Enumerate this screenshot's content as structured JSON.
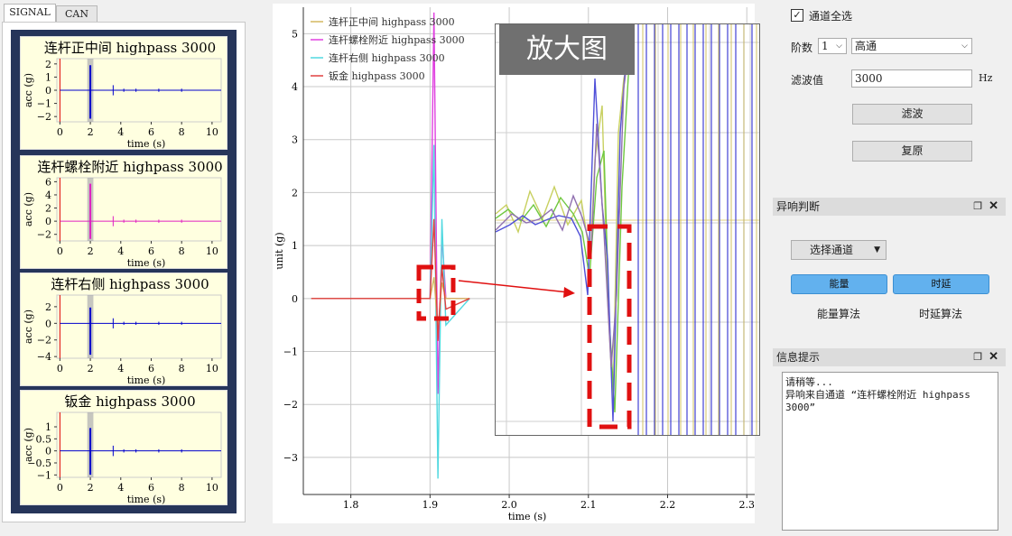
{
  "tabs": [
    {
      "label": "SIGNAL"
    },
    {
      "label": "CAN"
    }
  ],
  "minis": [
    {
      "title": "连杆正中间 highpass 3000",
      "color": "#0000cc",
      "yticks": [
        "2",
        "1",
        "0",
        "−1",
        "−2"
      ],
      "yvals": [
        2,
        1,
        0,
        -1,
        -2
      ],
      "ymin": -2.4,
      "ymax": 2.4
    },
    {
      "title": "连杆螺栓附近 highpass 3000",
      "color": "#e020c0",
      "yticks": [
        "6",
        "4",
        "2",
        "0",
        "−2"
      ],
      "yvals": [
        6,
        4,
        2,
        0,
        -2
      ],
      "ymin": -3,
      "ymax": 6.6
    },
    {
      "title": "连杆右侧 highpass 3000",
      "color": "#0000cc",
      "yticks": [
        "2",
        "0",
        "−2",
        "−4"
      ],
      "yvals": [
        2,
        0,
        -2,
        -4
      ],
      "ymin": -4.2,
      "ymax": 3.4
    },
    {
      "title": "钣金 highpass 3000",
      "color": "#0000cc",
      "yticks": [
        "1",
        "0.5",
        "0",
        "−0.5",
        "−1"
      ],
      "yvals": [
        1,
        0.5,
        0,
        -0.5,
        -1
      ],
      "ymin": -1.1,
      "ymax": 1.6
    }
  ],
  "mini_common": {
    "xlabel": "time (s)",
    "ylabel": "acc (g)",
    "xticks": [
      "0",
      "2",
      "4",
      "6",
      "8",
      "10"
    ]
  },
  "main_plot": {
    "ylabel": "unit (g)",
    "xlabel": "time (s)",
    "yticks": [
      "5",
      "4",
      "3",
      "2",
      "1",
      "0",
      "−1",
      "−2",
      "−3"
    ],
    "xticks": [
      "1.8",
      "1.9",
      "2.0",
      "2.1",
      "2.2",
      "2.3"
    ],
    "legend": [
      {
        "label": "连杆正中间 highpass 3000",
        "color": "#d4b860"
      },
      {
        "label": "连杆螺栓附近 highpass 3000",
        "color": "#e040e0"
      },
      {
        "label": "连杆右侧 highpass 3000",
        "color": "#50d8e0"
      },
      {
        "label": "钣金 highpass 3000",
        "color": "#e04040"
      }
    ],
    "zoom_label": "放大图"
  },
  "chart_data": {
    "type": "line",
    "xlabel": "time (s)",
    "ylabel": "unit (g)",
    "xlim": [
      1.74,
      2.31
    ],
    "ylim": [
      -3.7,
      5.5
    ],
    "series": [
      {
        "name": "连杆正中间 highpass 3000",
        "x": [
          1.75,
          1.9,
          1.905,
          1.91,
          1.915,
          1.92,
          1.95
        ],
        "y": [
          0,
          0,
          0.4,
          -0.6,
          0.3,
          0,
          0
        ]
      },
      {
        "name": "连杆螺栓附近 highpass 3000",
        "x": [
          1.75,
          1.9,
          1.905,
          1.91,
          1.915,
          1.92,
          1.95
        ],
        "y": [
          0,
          0,
          5.4,
          -1.8,
          1.2,
          0,
          0
        ]
      },
      {
        "name": "连杆右侧 highpass 3000",
        "x": [
          1.75,
          1.9,
          1.905,
          1.91,
          1.915,
          1.92,
          1.95
        ],
        "y": [
          0,
          0,
          2.9,
          -3.4,
          1.5,
          -0.5,
          0
        ]
      },
      {
        "name": "钣金 highpass 3000",
        "x": [
          1.75,
          1.9,
          1.905,
          1.91,
          1.915,
          1.92,
          1.95
        ],
        "y": [
          0,
          0,
          1.5,
          -0.8,
          0.6,
          -0.2,
          0
        ]
      }
    ]
  },
  "right": {
    "select_all": "通道全选",
    "order_label": "阶数",
    "order_value": "1",
    "filter_type": "高通",
    "filter_label": "滤波值",
    "filter_value": "3000",
    "unit": "Hz",
    "filter_btn": "滤波",
    "restore_btn": "复原",
    "abnormal_title": "异响判断",
    "channel_select": "选择通道",
    "energy_btn": "能量",
    "delay_btn": "时延",
    "energy_algo": "能量算法",
    "delay_algo": "时延算法",
    "info_title": "信息提示",
    "info_line1": "请稍等...",
    "info_line2": "异响来自通道 “连杆螺栓附近 highpass",
    "info_line3": "3000”"
  },
  "colors": {
    "navy": "#26355a",
    "plot_bg": "#ffffe0",
    "button_blue": "#62b1ee",
    "annotation_red": "#e01010"
  }
}
